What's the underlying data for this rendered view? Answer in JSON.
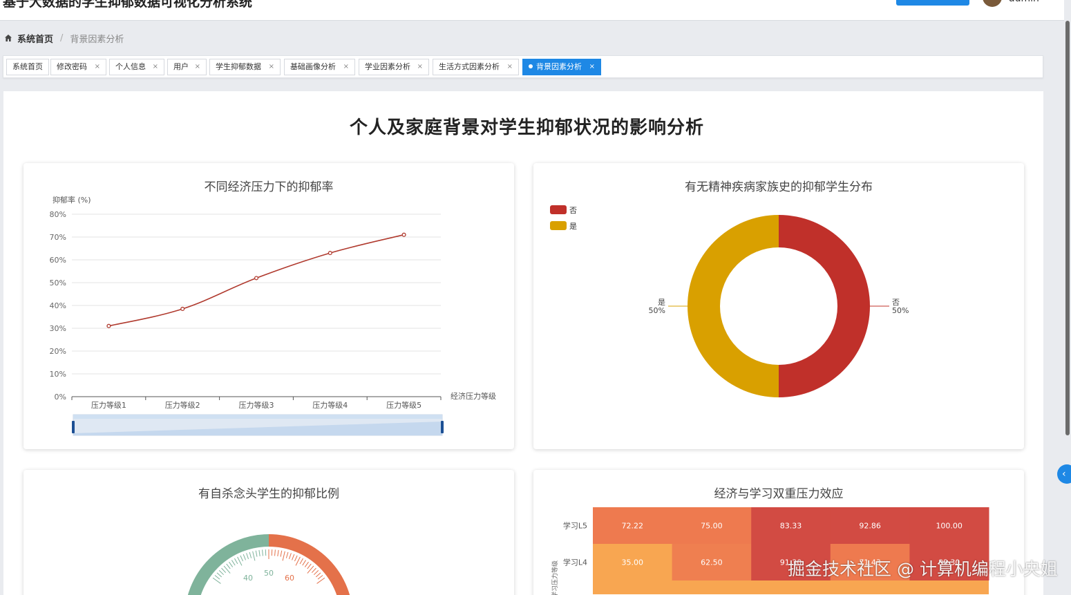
{
  "app": {
    "title": "基于大数据的学生抑郁数据可视化分析系统",
    "user": "admin"
  },
  "breadcrumb": {
    "home": "系统首页",
    "separator": "/",
    "current": "背景因素分析"
  },
  "tabs": [
    {
      "label": "系统首页",
      "closable": false,
      "active": false
    },
    {
      "label": "修改密码",
      "closable": true,
      "active": false
    },
    {
      "label": "个人信息",
      "closable": true,
      "active": false
    },
    {
      "label": "用户",
      "closable": true,
      "active": false
    },
    {
      "label": "学生抑郁数据",
      "closable": true,
      "active": false
    },
    {
      "label": "基础画像分析",
      "closable": true,
      "active": false
    },
    {
      "label": "学业因素分析",
      "closable": true,
      "active": false
    },
    {
      "label": "生活方式因素分析",
      "closable": true,
      "active": false
    },
    {
      "label": "背景因素分析",
      "closable": true,
      "active": true
    }
  ],
  "tab_close_glyph": "×",
  "page_title": "个人及家庭背景对学生抑郁状况的影响分析",
  "colors": {
    "accent": "#1e88e5",
    "line": "#b03a2e",
    "no": "#c0302a",
    "yes": "#d9a000"
  },
  "chart_data": [
    {
      "type": "line",
      "title": "不同经济压力下的抑郁率",
      "ylabel": "抑郁率 (%)",
      "xlabel": "经济压力等级",
      "categories": [
        "压力等级1",
        "压力等级2",
        "压力等级3",
        "压力等级4",
        "压力等级5"
      ],
      "values": [
        31,
        38.5,
        52,
        63,
        71
      ],
      "ylim": [
        0,
        80
      ],
      "yticks": [
        "0%",
        "10%",
        "20%",
        "30%",
        "40%",
        "50%",
        "60%",
        "70%",
        "80%"
      ],
      "grid": true,
      "datazoom": [
        0,
        100
      ]
    },
    {
      "type": "pie",
      "title": "有无精神疾病家族史的抑郁学生分布",
      "legend_position": "top-left",
      "slices": [
        {
          "name": "否",
          "value": 50,
          "label": "50%"
        },
        {
          "name": "是",
          "value": 50,
          "label": "50%"
        }
      ]
    },
    {
      "type": "gauge",
      "title": "有自杀念头学生的抑郁比例",
      "tick_labels": [
        "40",
        "50",
        "60"
      ]
    },
    {
      "type": "heatmap",
      "title": "经济与学习双重压力效应",
      "y_categories": [
        "学习L5",
        "学习L4"
      ],
      "y_axis_label": "学习压力等级",
      "rows": [
        {
          "label": "学习L5",
          "values": [
            "72.22",
            "75.00",
            "83.33",
            "92.86",
            "100.00"
          ]
        },
        {
          "label": "学习L4",
          "values": [
            "35.00",
            "62.50",
            "91.30",
            "71.43",
            "88.30"
          ]
        }
      ]
    }
  ],
  "watermark": "掘金技术社区 @ 计算机编程小央姐"
}
